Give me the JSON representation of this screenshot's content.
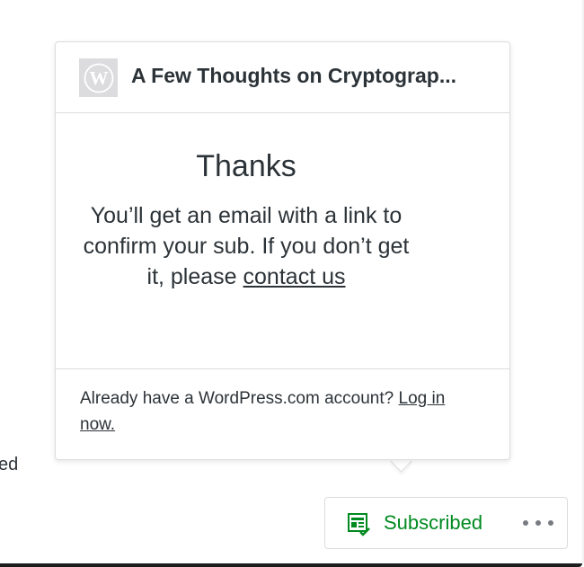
{
  "background": {
    "partial_text": "ed"
  },
  "popup": {
    "site_icon": "wordpress-logo-icon",
    "site_title": "A Few Thoughts on Cryptograp...",
    "heading": "Thanks",
    "message_text": "You’ll get an email with a link to confirm your sub. If you don’t get it, please ",
    "contact_link": "contact us",
    "footer_text": "Already have a WordPress.com account? ",
    "login_link": "Log in now."
  },
  "subscribe_button": {
    "icon": "reader-subscribed-icon",
    "label": "Subscribed",
    "more_icon": "ellipsis-icon"
  },
  "colors": {
    "accent_green": "#008a20",
    "text": "#2c3338",
    "border": "#dcdcde"
  }
}
